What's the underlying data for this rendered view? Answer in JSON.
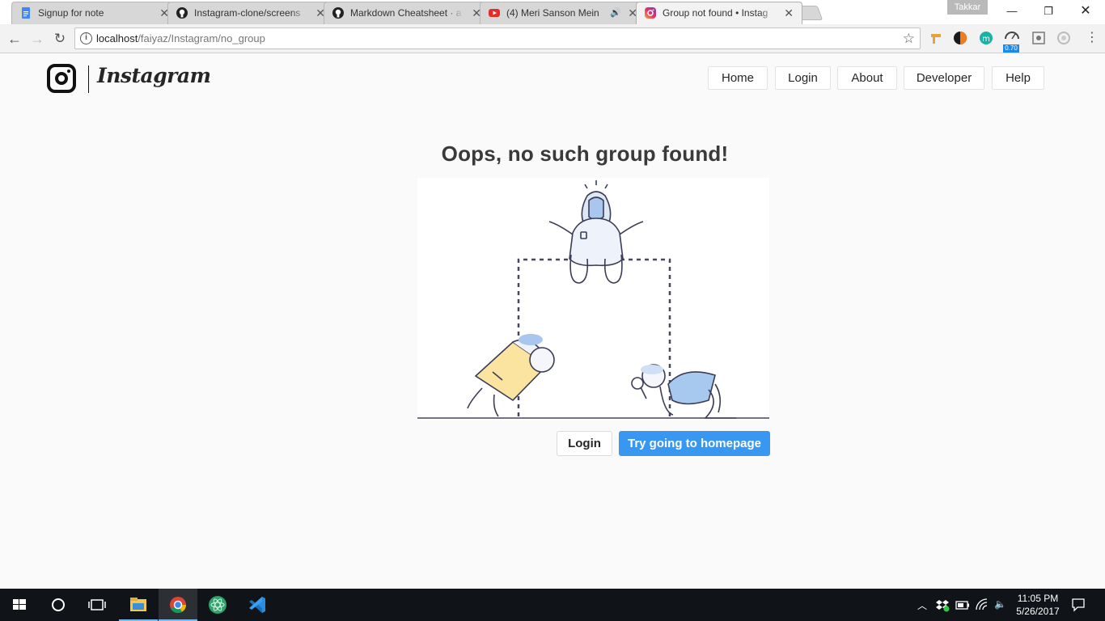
{
  "browser": {
    "tabs": [
      {
        "title": "Signup for note",
        "icon": "google-docs-icon",
        "active": false
      },
      {
        "title": "Instagram-clone/screens",
        "icon": "github-icon",
        "active": false
      },
      {
        "title": "Markdown Cheatsheet · a",
        "icon": "github-icon",
        "active": false
      },
      {
        "title": "(4) Meri Sanson Mein",
        "icon": "youtube-icon",
        "active": false,
        "playing": true
      },
      {
        "title": "Group not found • Instag",
        "icon": "instagram-icon",
        "active": true
      }
    ],
    "profile_name": "Takkar",
    "url_host": "localhost",
    "url_path": "/faiyaz/Instagram/no_group",
    "extension_badge": "0.70"
  },
  "site": {
    "brand": "Instagram",
    "nav": {
      "home": "Home",
      "login": "Login",
      "about": "About",
      "developer": "Developer",
      "help": "Help"
    },
    "headline": "Oops, no such group found!",
    "illustration": "searching-people-illustration",
    "buttons": {
      "login": "Login",
      "homepage": "Try going to homepage"
    },
    "colors": {
      "primary": "#3897f0",
      "text": "#262626",
      "background": "#fafafa"
    }
  },
  "taskbar": {
    "time": "11:05 PM",
    "date": "5/26/2017"
  }
}
